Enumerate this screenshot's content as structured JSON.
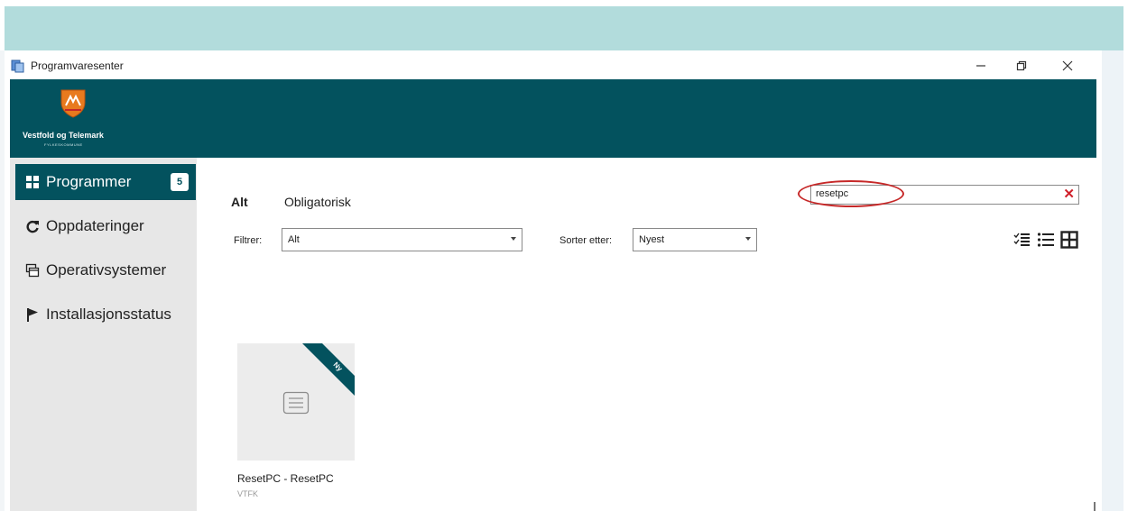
{
  "window": {
    "title": "Programvaresenter",
    "controls": [
      "minimize",
      "restore",
      "close"
    ]
  },
  "header": {
    "org_name": "Vestfold og Telemark",
    "org_subtitle": "FYLKESKOMMUNE",
    "bg_color": "#03525e"
  },
  "sidebar": {
    "items": [
      {
        "label": "Programmer",
        "icon": "grid-icon",
        "badge": "5",
        "active": true
      },
      {
        "label": "Oppdateringer",
        "icon": "refresh-icon",
        "active": false
      },
      {
        "label": "Operativsystemer",
        "icon": "windows-icon",
        "active": false
      },
      {
        "label": "Installasjonsstatus",
        "icon": "flag-icon",
        "active": false
      }
    ]
  },
  "tabs": [
    {
      "label": "Alt",
      "active": true
    },
    {
      "label": "Obligatorisk",
      "active": false
    }
  ],
  "search": {
    "value": "resetpc",
    "clear_icon": "close-x-icon",
    "highlight_color": "#c62828"
  },
  "filters": {
    "filter_label": "Filtrer:",
    "filter_value": "Alt",
    "sort_label": "Sorter etter:",
    "sort_value": "Nyest"
  },
  "view_modes": [
    "checklist-view-icon",
    "list-view-icon",
    "grid-view-icon"
  ],
  "apps": [
    {
      "name": "ResetPC - ResetPC",
      "vendor": "VTFK",
      "ribbon": "Ny",
      "icon": "app-placeholder-icon"
    }
  ]
}
